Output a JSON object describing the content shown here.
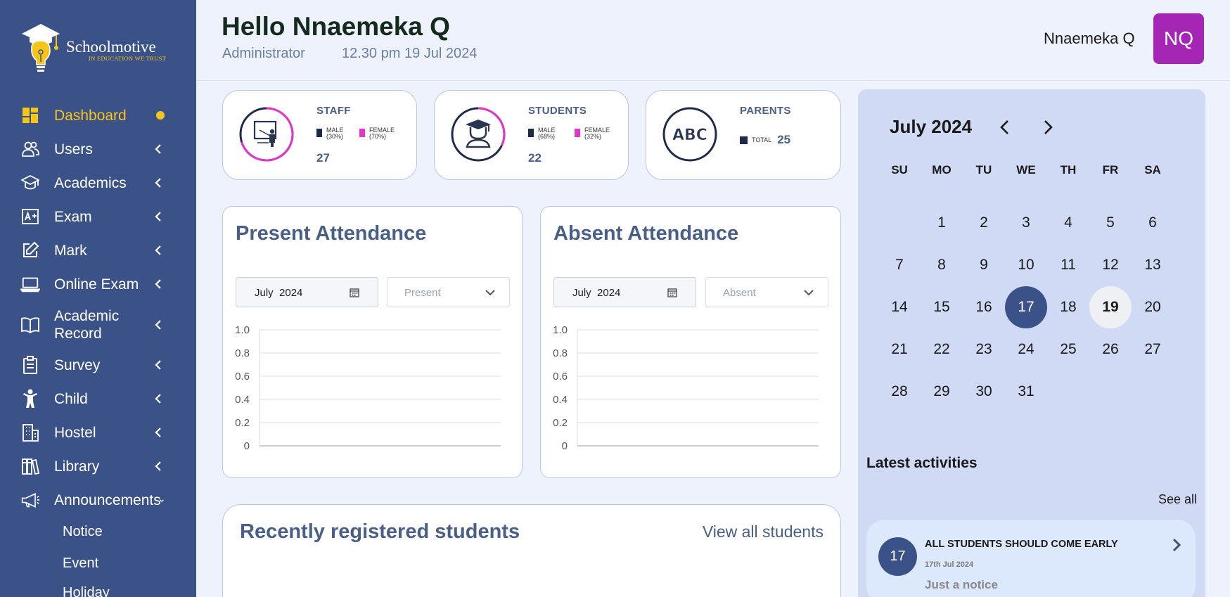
{
  "brand": {
    "name": "Schoolmotive",
    "tagline": "IN EDUCATION WE TRUST"
  },
  "colors": {
    "sidebar": "#3b5288",
    "accent": "#f5c518",
    "avatar": "#a526b4",
    "female": "#e633c8",
    "male": "#1d2a4a",
    "selected_day": "#3b5288"
  },
  "sidebar": {
    "items": [
      {
        "label": "Dashboard",
        "icon": "dashboard-grid-icon",
        "active": true
      },
      {
        "label": "Users",
        "icon": "users-icon"
      },
      {
        "label": "Academics",
        "icon": "graduation-cap-icon"
      },
      {
        "label": "Exam",
        "icon": "exam-a-plus-icon"
      },
      {
        "label": "Mark",
        "icon": "edit-pencil-icon"
      },
      {
        "label": "Online Exam",
        "icon": "laptop-icon"
      },
      {
        "label": "Academic Record",
        "icon": "open-book-icon"
      },
      {
        "label": "Survey",
        "icon": "clipboard-icon"
      },
      {
        "label": "Child",
        "icon": "child-icon"
      },
      {
        "label": "Hostel",
        "icon": "building-icon"
      },
      {
        "label": "Library",
        "icon": "books-icon"
      },
      {
        "label": "Announcements",
        "icon": "megaphone-icon",
        "expanded": true
      }
    ],
    "sub_items": [
      "Notice",
      "Event",
      "Holiday"
    ]
  },
  "header": {
    "greeting": "Hello Nnaemeka Q",
    "role": "Administrator",
    "datetime": "12.30 pm 19 Jul 2024",
    "user_name": "Nnaemeka Q",
    "avatar_initials": "NQ"
  },
  "stats": {
    "staff": {
      "title": "STAFF",
      "male_label": "MALE",
      "male_pct": "(30%)",
      "female_label": "FEMALE",
      "female_pct": "(70%)",
      "total": "27",
      "female_fraction": 0.7,
      "icon": "teacher-board-icon"
    },
    "students": {
      "title": "STUDENTS",
      "male_label": "MALE",
      "male_pct": "(68%)",
      "female_label": "FEMALE",
      "female_pct": "(32%)",
      "total": "22",
      "female_fraction": 0.32,
      "icon": "student-cap-icon"
    },
    "parents": {
      "title": "PARENTS",
      "total_label": "TOTAL",
      "total": "25",
      "icon": "abc-icon",
      "icon_text": "ABC"
    }
  },
  "present": {
    "title": "Present Attendance",
    "date": "July  2024",
    "select_value": "Present",
    "calendar_icon": "calendar-icon",
    "chevron_icon": "chevron-down-icon"
  },
  "absent": {
    "title": "Absent Attendance",
    "date": "July  2024",
    "select_value": "Absent",
    "calendar_icon": "calendar-icon",
    "chevron_icon": "chevron-down-icon"
  },
  "chart_data": [
    {
      "type": "bar",
      "categories": [],
      "values": [],
      "yticks": [
        "1.0",
        "0.8",
        "0.6",
        "0.4",
        "0.2",
        "0"
      ],
      "ylim": [
        0,
        1
      ],
      "grid": true,
      "xlabel": "",
      "ylabel": ""
    },
    {
      "type": "bar",
      "categories": [],
      "values": [],
      "yticks": [
        "1.0",
        "0.8",
        "0.6",
        "0.4",
        "0.2",
        "0"
      ],
      "ylim": [
        0,
        1
      ],
      "grid": true,
      "xlabel": "",
      "ylabel": ""
    }
  ],
  "recent": {
    "title": "Recently registered students",
    "link": "View all students"
  },
  "calendar": {
    "month": "July 2024",
    "weekdays": [
      "SU",
      "MO",
      "TU",
      "WE",
      "TH",
      "FR",
      "SA"
    ],
    "first_weekday": 1,
    "days_in_month": 31,
    "selected": 17,
    "today": 19
  },
  "activities": {
    "title": "Latest activities",
    "see_all": "See all",
    "items": [
      {
        "day": "17",
        "heading": "ALL STUDENTS SHOULD COME EARLY",
        "date": "17th Jul 2024",
        "description": "Just a notice"
      }
    ]
  }
}
